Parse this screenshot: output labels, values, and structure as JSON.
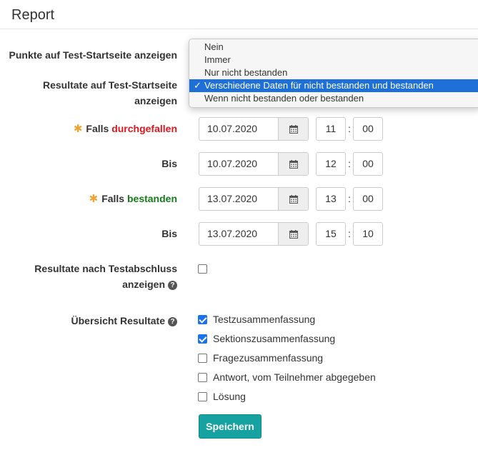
{
  "page": {
    "title": "Report"
  },
  "points_start_page": {
    "label": "Punkte auf Test-Startseite anzeigen",
    "options": [
      "Nein",
      "Immer",
      "Nur nicht bestanden",
      "Verschiedene Daten für nicht bestanden und bestanden",
      "Wenn nicht bestanden oder bestanden"
    ],
    "selected_index": 3,
    "check_glyph": "✓"
  },
  "results_start_page": {
    "label_line1": "Resultate auf Test-Startseite",
    "label_line2": "anzeigen"
  },
  "failed": {
    "prefix": "Falls",
    "keyword": "durchgefallen",
    "keyword_color": "#e0161c",
    "from_date": "10.07.2020",
    "from_hour": "11",
    "from_min": "00",
    "to_label": "Bis",
    "to_date": "10.07.2020",
    "to_hour": "12",
    "to_min": "00"
  },
  "passed": {
    "prefix": "Falls",
    "keyword": "bestanden",
    "keyword_color": "#167b1a",
    "from_date": "13.07.2020",
    "from_hour": "13",
    "from_min": "00",
    "to_label": "Bis",
    "to_date": "13.07.2020",
    "to_hour": "15",
    "to_min": "10"
  },
  "required_marker": "✱",
  "time_separator": ":",
  "after_completion": {
    "label_line1": "Resultate nach Testabschluss",
    "label_line2": "anzeigen",
    "checked": false
  },
  "overview": {
    "label": "Übersicht Resultate",
    "options": [
      {
        "label": "Testzusammenfassung",
        "checked": true
      },
      {
        "label": "Sektionszusammenfassung",
        "checked": true
      },
      {
        "label": "Fragezusammenfassung",
        "checked": false
      },
      {
        "label": "Antwort, vom Teilnehmer abgegeben",
        "checked": false
      },
      {
        "label": "Lösung",
        "checked": false
      }
    ]
  },
  "help_glyph": "?",
  "save_label": "Speichern",
  "icons": {
    "calendar": "calendar-icon",
    "help": "question-circle-icon",
    "required": "asterisk-icon",
    "check": "checkmark-icon"
  },
  "colors": {
    "accent": "#17a2a2",
    "selection": "#1f6fd9",
    "required": "#f0a234"
  }
}
